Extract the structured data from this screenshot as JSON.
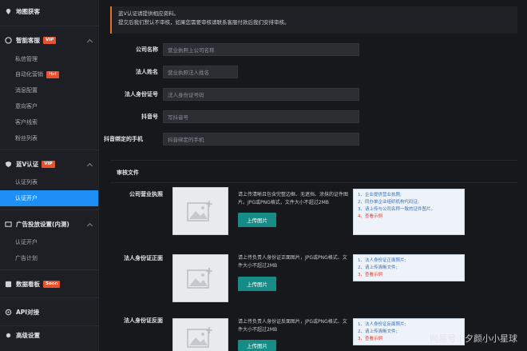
{
  "sidebar": {
    "group_site": "地图获客",
    "group_smart": "智能客服",
    "smart_badge": "VIP",
    "smart_items": [
      "私信管理",
      "自动化营销",
      "消息配置",
      "意向客户",
      "客户线索",
      "粉丝列表"
    ],
    "smart_hot_badge": "Hot",
    "group_blue_v": "蓝V认证",
    "blue_v_badge": "VIP",
    "blue_v_items": [
      "认证列表",
      "认证开户"
    ],
    "group_ads": "广告投放设置(内测)",
    "ads_items": [
      "认证开户",
      "广告计划"
    ],
    "group_data": "数据看板",
    "data_badge": "Soon",
    "group_api": "API对接",
    "group_more": "高级设置"
  },
  "notice": {
    "line1": "蓝V认证请提供相应资料。",
    "line2": "提交后我们默认不审核，如果您需要审核请联系客服付款后我们安排审核。"
  },
  "form": {
    "company_label": "公司名称",
    "company_placeholder": "营业执照上公司名称",
    "legal_label": "法人姓名",
    "legal_placeholder": "营业执照法人姓名",
    "id_label": "法人身份证号",
    "id_placeholder": "法人身份证号码",
    "douyin_label": "抖音号",
    "douyin_placeholder": "写抖音号",
    "phone_label": "抖音绑定的手机",
    "phone_placeholder": "抖音绑定的手机"
  },
  "docs": {
    "section_title": "审核文件",
    "upload_label": "上传图片",
    "license": {
      "label": "公司营业执照",
      "desc": "请上传清晰且包含完整边框、无遮挡、涂抹的证件图片。JPG或PNG格式，文件大小不超过2MB",
      "tips": [
        "1、企业提供营业执照;",
        "2、同办单企业组织机构代码证;",
        "3、请上传与公司名称一致的证件图片。",
        "4、查看示例"
      ]
    },
    "id_front": {
      "label": "法人身份证正面",
      "desc": "请上传负责人身份证正面图片，JPG或PNG格式、文件大小不超过2MB",
      "tips": [
        "1、法人身份证正面照片;",
        "2、请上传清晰文件;",
        "3、查看示例"
      ]
    },
    "id_back": {
      "label": "法人身份证反面",
      "desc": "请上传负责人身份证反面图片，JPG或PNG格式、文件大小不超过2MB",
      "tips": [
        "1、法人身份证反面照片;",
        "2、请上传清晰文件;",
        "3、查看示例"
      ]
    }
  },
  "watermark": "网易号 | 夕颜小小星球"
}
